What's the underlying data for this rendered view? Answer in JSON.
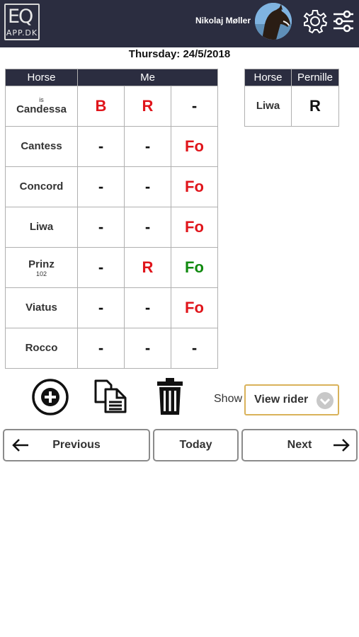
{
  "header": {
    "logo_top": "EQ",
    "logo_bottom": "APP.DK",
    "username": "Nikolaj Møller",
    "avatar_icon": "horse-avatar",
    "settings_icon": "gear-icon",
    "filter_icon": "sliders-icon"
  },
  "date_label": "Thursday: 24/5/2018",
  "main_table": {
    "headers": [
      "Horse",
      "Me"
    ],
    "rows": [
      {
        "sup": "is",
        "name": "Candessa",
        "sub": "",
        "cells": [
          {
            "v": "B",
            "color": "#e0151b"
          },
          {
            "v": "R",
            "color": "#e0151b"
          },
          {
            "v": "-",
            "color": "#111111"
          }
        ]
      },
      {
        "sup": "",
        "name": "Cantess",
        "sub": "",
        "cells": [
          {
            "v": "-",
            "color": "#111111"
          },
          {
            "v": "-",
            "color": "#111111"
          },
          {
            "v": "Fo",
            "color": "#e0151b"
          }
        ]
      },
      {
        "sup": "",
        "name": "Concord",
        "sub": "",
        "cells": [
          {
            "v": "-",
            "color": "#111111"
          },
          {
            "v": "-",
            "color": "#111111"
          },
          {
            "v": "Fo",
            "color": "#e0151b"
          }
        ]
      },
      {
        "sup": "",
        "name": "Liwa",
        "sub": "",
        "cells": [
          {
            "v": "-",
            "color": "#111111"
          },
          {
            "v": "-",
            "color": "#111111"
          },
          {
            "v": "Fo",
            "color": "#e0151b"
          }
        ]
      },
      {
        "sup": "",
        "name": "Prinz",
        "sub": "102",
        "cells": [
          {
            "v": "-",
            "color": "#111111"
          },
          {
            "v": "R",
            "color": "#e0151b"
          },
          {
            "v": "Fo",
            "color": "#118a10"
          }
        ]
      },
      {
        "sup": "",
        "name": "Viatus",
        "sub": "",
        "cells": [
          {
            "v": "-",
            "color": "#111111"
          },
          {
            "v": "-",
            "color": "#111111"
          },
          {
            "v": "Fo",
            "color": "#e0151b"
          }
        ]
      },
      {
        "sup": "",
        "name": "Rocco",
        "sub": "",
        "cells": [
          {
            "v": "-",
            "color": "#111111"
          },
          {
            "v": "-",
            "color": "#111111"
          },
          {
            "v": "-",
            "color": "#111111"
          }
        ]
      }
    ]
  },
  "side_table": {
    "headers": [
      "Horse",
      "Pernille"
    ],
    "rows": [
      {
        "name": "Liwa",
        "value": "R",
        "color": "#111111"
      }
    ]
  },
  "actions": {
    "add_icon": "plus-circle-icon",
    "copy_icon": "copy-documents-icon",
    "delete_icon": "trash-icon"
  },
  "show": {
    "label": "Show",
    "selected": "View rider",
    "arrow_icon": "chevron-down-icon"
  },
  "nav": {
    "previous": "Previous",
    "today": "Today",
    "next": "Next"
  },
  "colors": {
    "header_bg": "#2b2d40",
    "red": "#e0151b",
    "green": "#118a10",
    "select_border": "#d9b25a"
  }
}
